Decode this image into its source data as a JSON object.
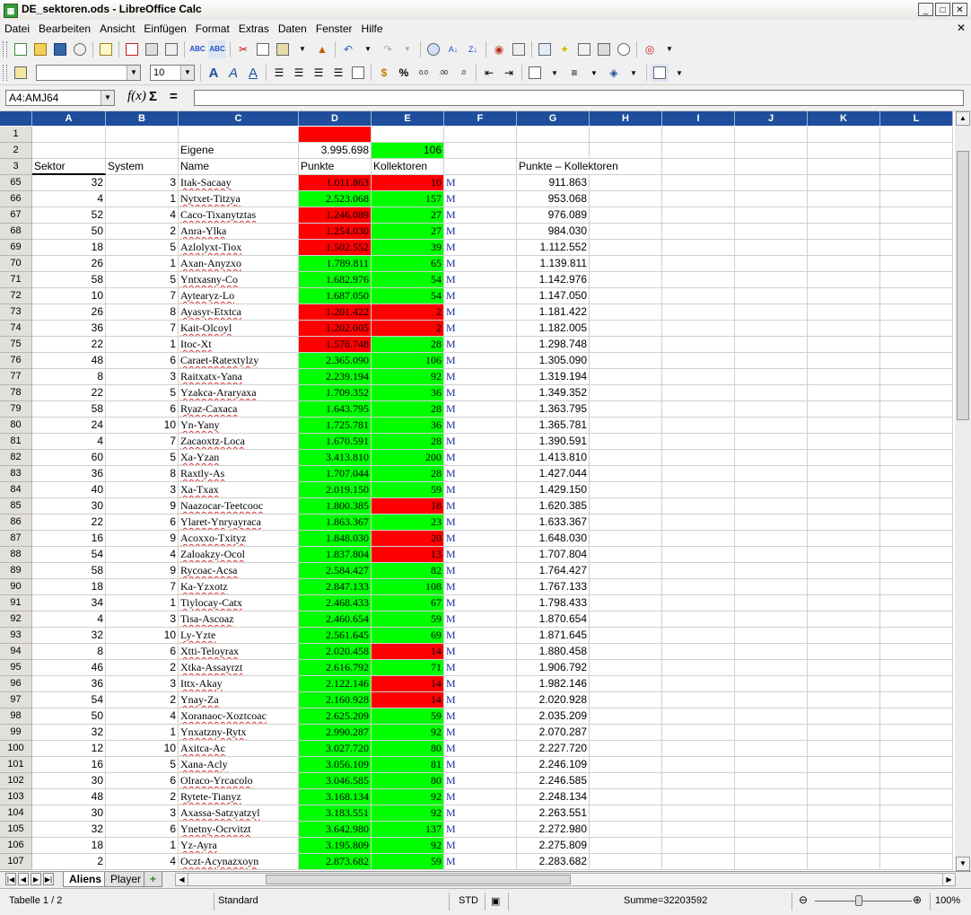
{
  "window": {
    "title": "DE_sektoren.ods - LibreOffice Calc",
    "app_icon": "spreadsheet-icon"
  },
  "menu": [
    "Datei",
    "Bearbeiten",
    "Ansicht",
    "Einfügen",
    "Format",
    "Extras",
    "Daten",
    "Fenster",
    "Hilfe"
  ],
  "formatting": {
    "font_name": "",
    "font_size": "10"
  },
  "formula_bar": {
    "name_box": "A4:AMJ64",
    "content": ""
  },
  "colors": {
    "red": "#ff0000",
    "green": "#00ff00",
    "header_blue": "#1f4e9c"
  },
  "columns": [
    "A",
    "B",
    "C",
    "D",
    "E",
    "F",
    "G",
    "H",
    "I",
    "J",
    "K",
    "L"
  ],
  "header_rows": {
    "r2": {
      "num": "2",
      "C": "Eigene",
      "D": "3.995.698",
      "E": "106"
    },
    "r3": {
      "num": "3",
      "A": "Sektor",
      "B": "System",
      "C": "Name",
      "D": "Punkte",
      "E": "Kollektoren",
      "G": "Punkte – Kollektoren"
    }
  },
  "row1_num": "1",
  "flag": "M",
  "rows": [
    [
      "65",
      "32",
      "3",
      "Itak-Sacaay",
      "1.011.863",
      "10",
      "911.863",
      "r",
      "r"
    ],
    [
      "66",
      "4",
      "1",
      "Nytxet-Titzya",
      "2.523.068",
      "157",
      "953.068",
      "g",
      "g"
    ],
    [
      "67",
      "52",
      "4",
      "Caco-Tixanytztas",
      "1.246.089",
      "27",
      "976.089",
      "r",
      "g"
    ],
    [
      "68",
      "50",
      "2",
      "Anra-Ylka",
      "1.254.030",
      "27",
      "984.030",
      "r",
      "g"
    ],
    [
      "69",
      "18",
      "5",
      "Azlolyxt-Tiox",
      "1.502.552",
      "39",
      "1.112.552",
      "r",
      "g"
    ],
    [
      "70",
      "26",
      "1",
      "Axan-Anyzxo",
      "1.789.811",
      "65",
      "1.139.811",
      "g",
      "g"
    ],
    [
      "71",
      "58",
      "5",
      "Yntxasny-Co",
      "1.682.976",
      "54",
      "1.142.976",
      "g",
      "g"
    ],
    [
      "72",
      "10",
      "7",
      "Aytearyz-Lo",
      "1.687.050",
      "54",
      "1.147.050",
      "g",
      "g"
    ],
    [
      "73",
      "26",
      "8",
      "Ayasyr-Etxtca",
      "1.201.422",
      "2",
      "1.181.422",
      "r",
      "r"
    ],
    [
      "74",
      "36",
      "7",
      "Kait-Olcoyl",
      "1.202.005",
      "2",
      "1.182.005",
      "r",
      "r"
    ],
    [
      "75",
      "22",
      "1",
      "Itoc-Xt",
      "1.578.748",
      "28",
      "1.298.748",
      "r",
      "g"
    ],
    [
      "76",
      "48",
      "6",
      "Caraet-Ratextylzy",
      "2.365.090",
      "106",
      "1.305.090",
      "g",
      "g"
    ],
    [
      "77",
      "8",
      "3",
      "Raitxatx-Yana",
      "2.239.194",
      "92",
      "1.319.194",
      "g",
      "g"
    ],
    [
      "78",
      "22",
      "5",
      "Yzakca-Araryaxa",
      "1.709.352",
      "36",
      "1.349.352",
      "g",
      "g"
    ],
    [
      "79",
      "58",
      "6",
      "Ryaz-Caxaca",
      "1.643.795",
      "28",
      "1.363.795",
      "g",
      "g"
    ],
    [
      "80",
      "24",
      "10",
      "Yn-Yany",
      "1.725.781",
      "36",
      "1.365.781",
      "g",
      "g"
    ],
    [
      "81",
      "4",
      "7",
      "Zacaoxtz-Loca",
      "1.670.591",
      "28",
      "1.390.591",
      "g",
      "g"
    ],
    [
      "82",
      "60",
      "5",
      "Xa-Yzan",
      "3.413.810",
      "200",
      "1.413.810",
      "g",
      "g"
    ],
    [
      "83",
      "36",
      "8",
      "Raxtly-As",
      "1.707.044",
      "28",
      "1.427.044",
      "g",
      "g"
    ],
    [
      "84",
      "40",
      "3",
      "Xa-Txax",
      "2.019.150",
      "59",
      "1.429.150",
      "g",
      "g"
    ],
    [
      "85",
      "30",
      "9",
      "Naazocar-Teetcooc",
      "1.800.385",
      "18",
      "1.620.385",
      "g",
      "r"
    ],
    [
      "86",
      "22",
      "6",
      "Ylaret-Ynryayraca",
      "1.863.367",
      "23",
      "1.633.367",
      "g",
      "g"
    ],
    [
      "87",
      "16",
      "9",
      "Acoxxo-Txityz",
      "1.848.030",
      "20",
      "1.648.030",
      "g",
      "r"
    ],
    [
      "88",
      "54",
      "4",
      "Zaloakzy-Ocol",
      "1.837.804",
      "13",
      "1.707.804",
      "g",
      "r"
    ],
    [
      "89",
      "58",
      "9",
      "Rycoac-Acsa",
      "2.584.427",
      "82",
      "1.764.427",
      "g",
      "g"
    ],
    [
      "90",
      "18",
      "7",
      "Ka-Yzxotz",
      "2.847.133",
      "108",
      "1.767.133",
      "g",
      "g"
    ],
    [
      "91",
      "34",
      "1",
      "Tiylocay-Catx",
      "2.468.433",
      "67",
      "1.798.433",
      "g",
      "g"
    ],
    [
      "92",
      "4",
      "3",
      "Tisa-Ascoaz",
      "2.460.654",
      "59",
      "1.870.654",
      "g",
      "g"
    ],
    [
      "93",
      "32",
      "10",
      "Ly-Yzte",
      "2.561.645",
      "69",
      "1.871.645",
      "g",
      "g"
    ],
    [
      "94",
      "8",
      "6",
      "Xtti-Teloyrax",
      "2.020.458",
      "14",
      "1.880.458",
      "g",
      "r"
    ],
    [
      "95",
      "46",
      "2",
      "Xtka-Assayrzt",
      "2.616.792",
      "71",
      "1.906.792",
      "g",
      "g"
    ],
    [
      "96",
      "36",
      "3",
      "Ittx-Akay",
      "2.122.146",
      "14",
      "1.982.146",
      "g",
      "r"
    ],
    [
      "97",
      "54",
      "2",
      "Ynay-Za",
      "2.160.928",
      "14",
      "2.020.928",
      "g",
      "r"
    ],
    [
      "98",
      "50",
      "4",
      "Xoranaoc-Xoztcoac",
      "2.625.209",
      "59",
      "2.035.209",
      "g",
      "g"
    ],
    [
      "99",
      "32",
      "1",
      "Ynxatzny-Rytx",
      "2.990.287",
      "92",
      "2.070.287",
      "g",
      "g"
    ],
    [
      "100",
      "12",
      "10",
      "Axitca-Ac",
      "3.027.720",
      "80",
      "2.227.720",
      "g",
      "g"
    ],
    [
      "101",
      "16",
      "5",
      "Xana-Acly",
      "3.056.109",
      "81",
      "2.246.109",
      "g",
      "g"
    ],
    [
      "102",
      "30",
      "6",
      "Olraco-Yrcacolo",
      "3.046.585",
      "80",
      "2.246.585",
      "g",
      "g"
    ],
    [
      "103",
      "48",
      "2",
      "Rytete-Tianyz",
      "3.168.134",
      "92",
      "2.248.134",
      "g",
      "g"
    ],
    [
      "104",
      "30",
      "3",
      "Axassa-Satzyatzyl",
      "3.183.551",
      "92",
      "2.263.551",
      "g",
      "g"
    ],
    [
      "105",
      "32",
      "6",
      "Ynetny-Ocrvitzt",
      "3.642.980",
      "137",
      "2.272.980",
      "g",
      "g"
    ],
    [
      "106",
      "18",
      "1",
      "Yz-Ayra",
      "3.195.809",
      "92",
      "2.275.809",
      "g",
      "g"
    ],
    [
      "107",
      "2",
      "4",
      "Oczt-Acynazxoyn",
      "2.873.682",
      "59",
      "2.283.682",
      "g",
      "g"
    ]
  ],
  "sheet_tabs": [
    "Aliens",
    "Player"
  ],
  "status": {
    "sheet": "Tabelle 1 / 2",
    "style": "Standard",
    "mode": "STD",
    "sum": "Summe=32203592",
    "zoom": "100%"
  }
}
